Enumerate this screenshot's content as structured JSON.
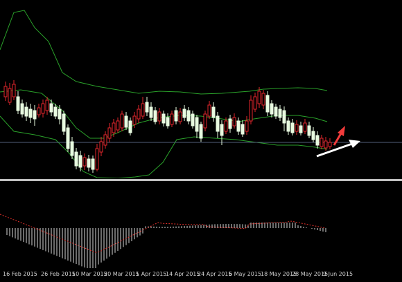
{
  "chart": {
    "colors": {
      "background": "#000000",
      "bollinger": "#2aa12a",
      "bull_candle": "#e8fbe0",
      "bear_candle": "#e4262c",
      "horizontal_line": "#52607a",
      "histogram": "#d8d8d8",
      "signal_line": "#e0302a",
      "annotation_white": "#ffffff",
      "annotation_red": "#f23b3b"
    },
    "annotations": [
      {
        "type": "arrow",
        "color": "white"
      },
      {
        "type": "arrow",
        "color": "red"
      }
    ]
  },
  "time_axis": {
    "labels": [
      "16 Feb 2015",
      "26 Feb 2015",
      "10 Mar 2015",
      "20 Mar 2015",
      "1 Apr 2015",
      "14 Apr 2015",
      "24 Apr 2015",
      "6 May 2015",
      "18 May 2015",
      "28 May 2015",
      "9 Jun 2015"
    ]
  }
}
